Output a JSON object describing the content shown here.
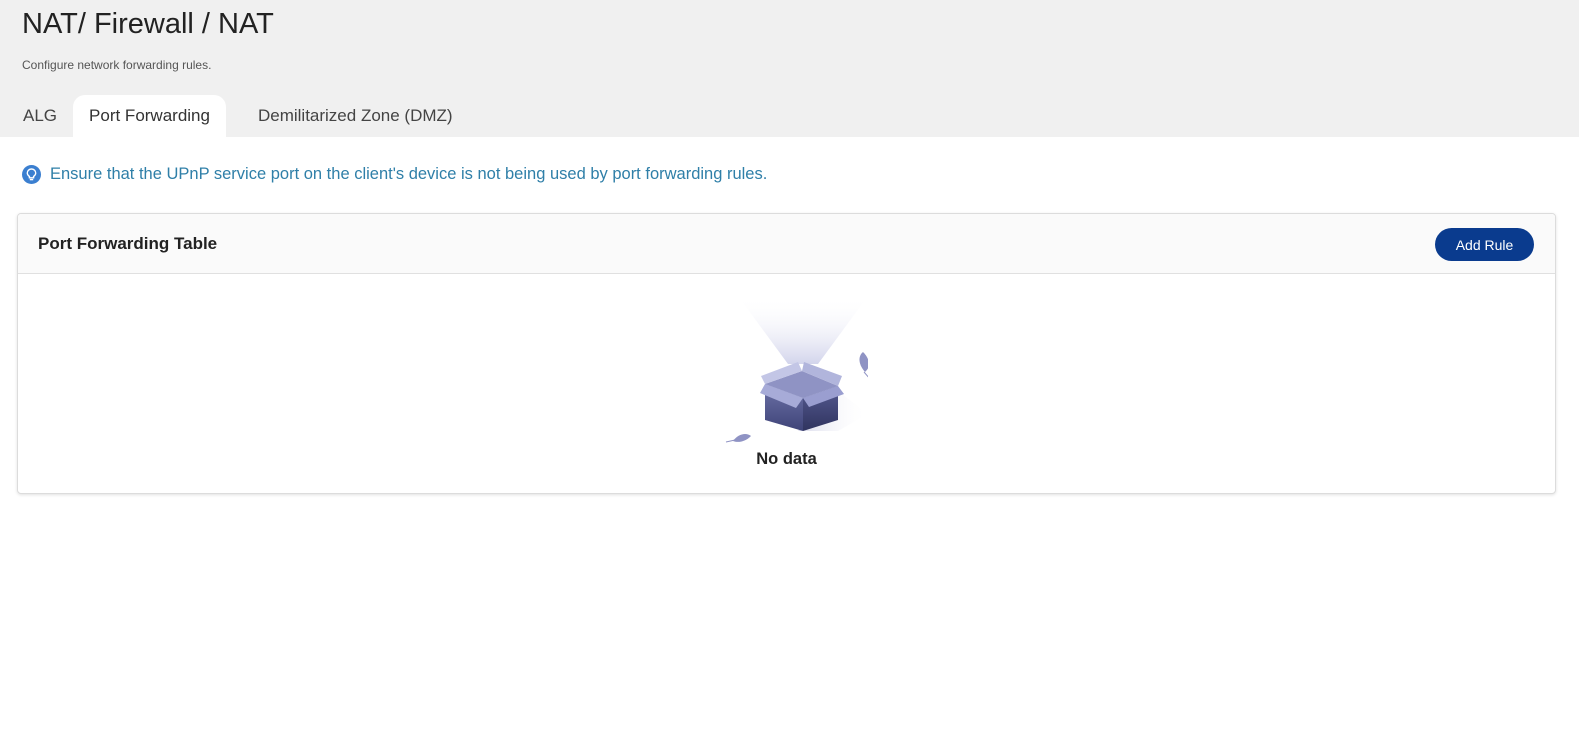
{
  "header": {
    "title": "NAT/ Firewall / NAT",
    "subtitle": "Configure network forwarding rules."
  },
  "tabs": [
    {
      "label": "ALG",
      "active": false
    },
    {
      "label": "Port Forwarding",
      "active": true
    },
    {
      "label": "Demilitarized Zone (DMZ)",
      "active": false
    }
  ],
  "tip": {
    "icon": "lightbulb-icon",
    "text": "Ensure that the UPnP service port on the client's device is not being used by port forwarding rules.",
    "color": "#2f7fa8"
  },
  "table": {
    "title": "Port Forwarding Table",
    "add_button_label": "Add Rule",
    "empty_text": "No data",
    "empty_icon": "empty-box-icon"
  },
  "colors": {
    "accent": "#0a3b8e",
    "tip_icon": "#3b7fd0"
  }
}
